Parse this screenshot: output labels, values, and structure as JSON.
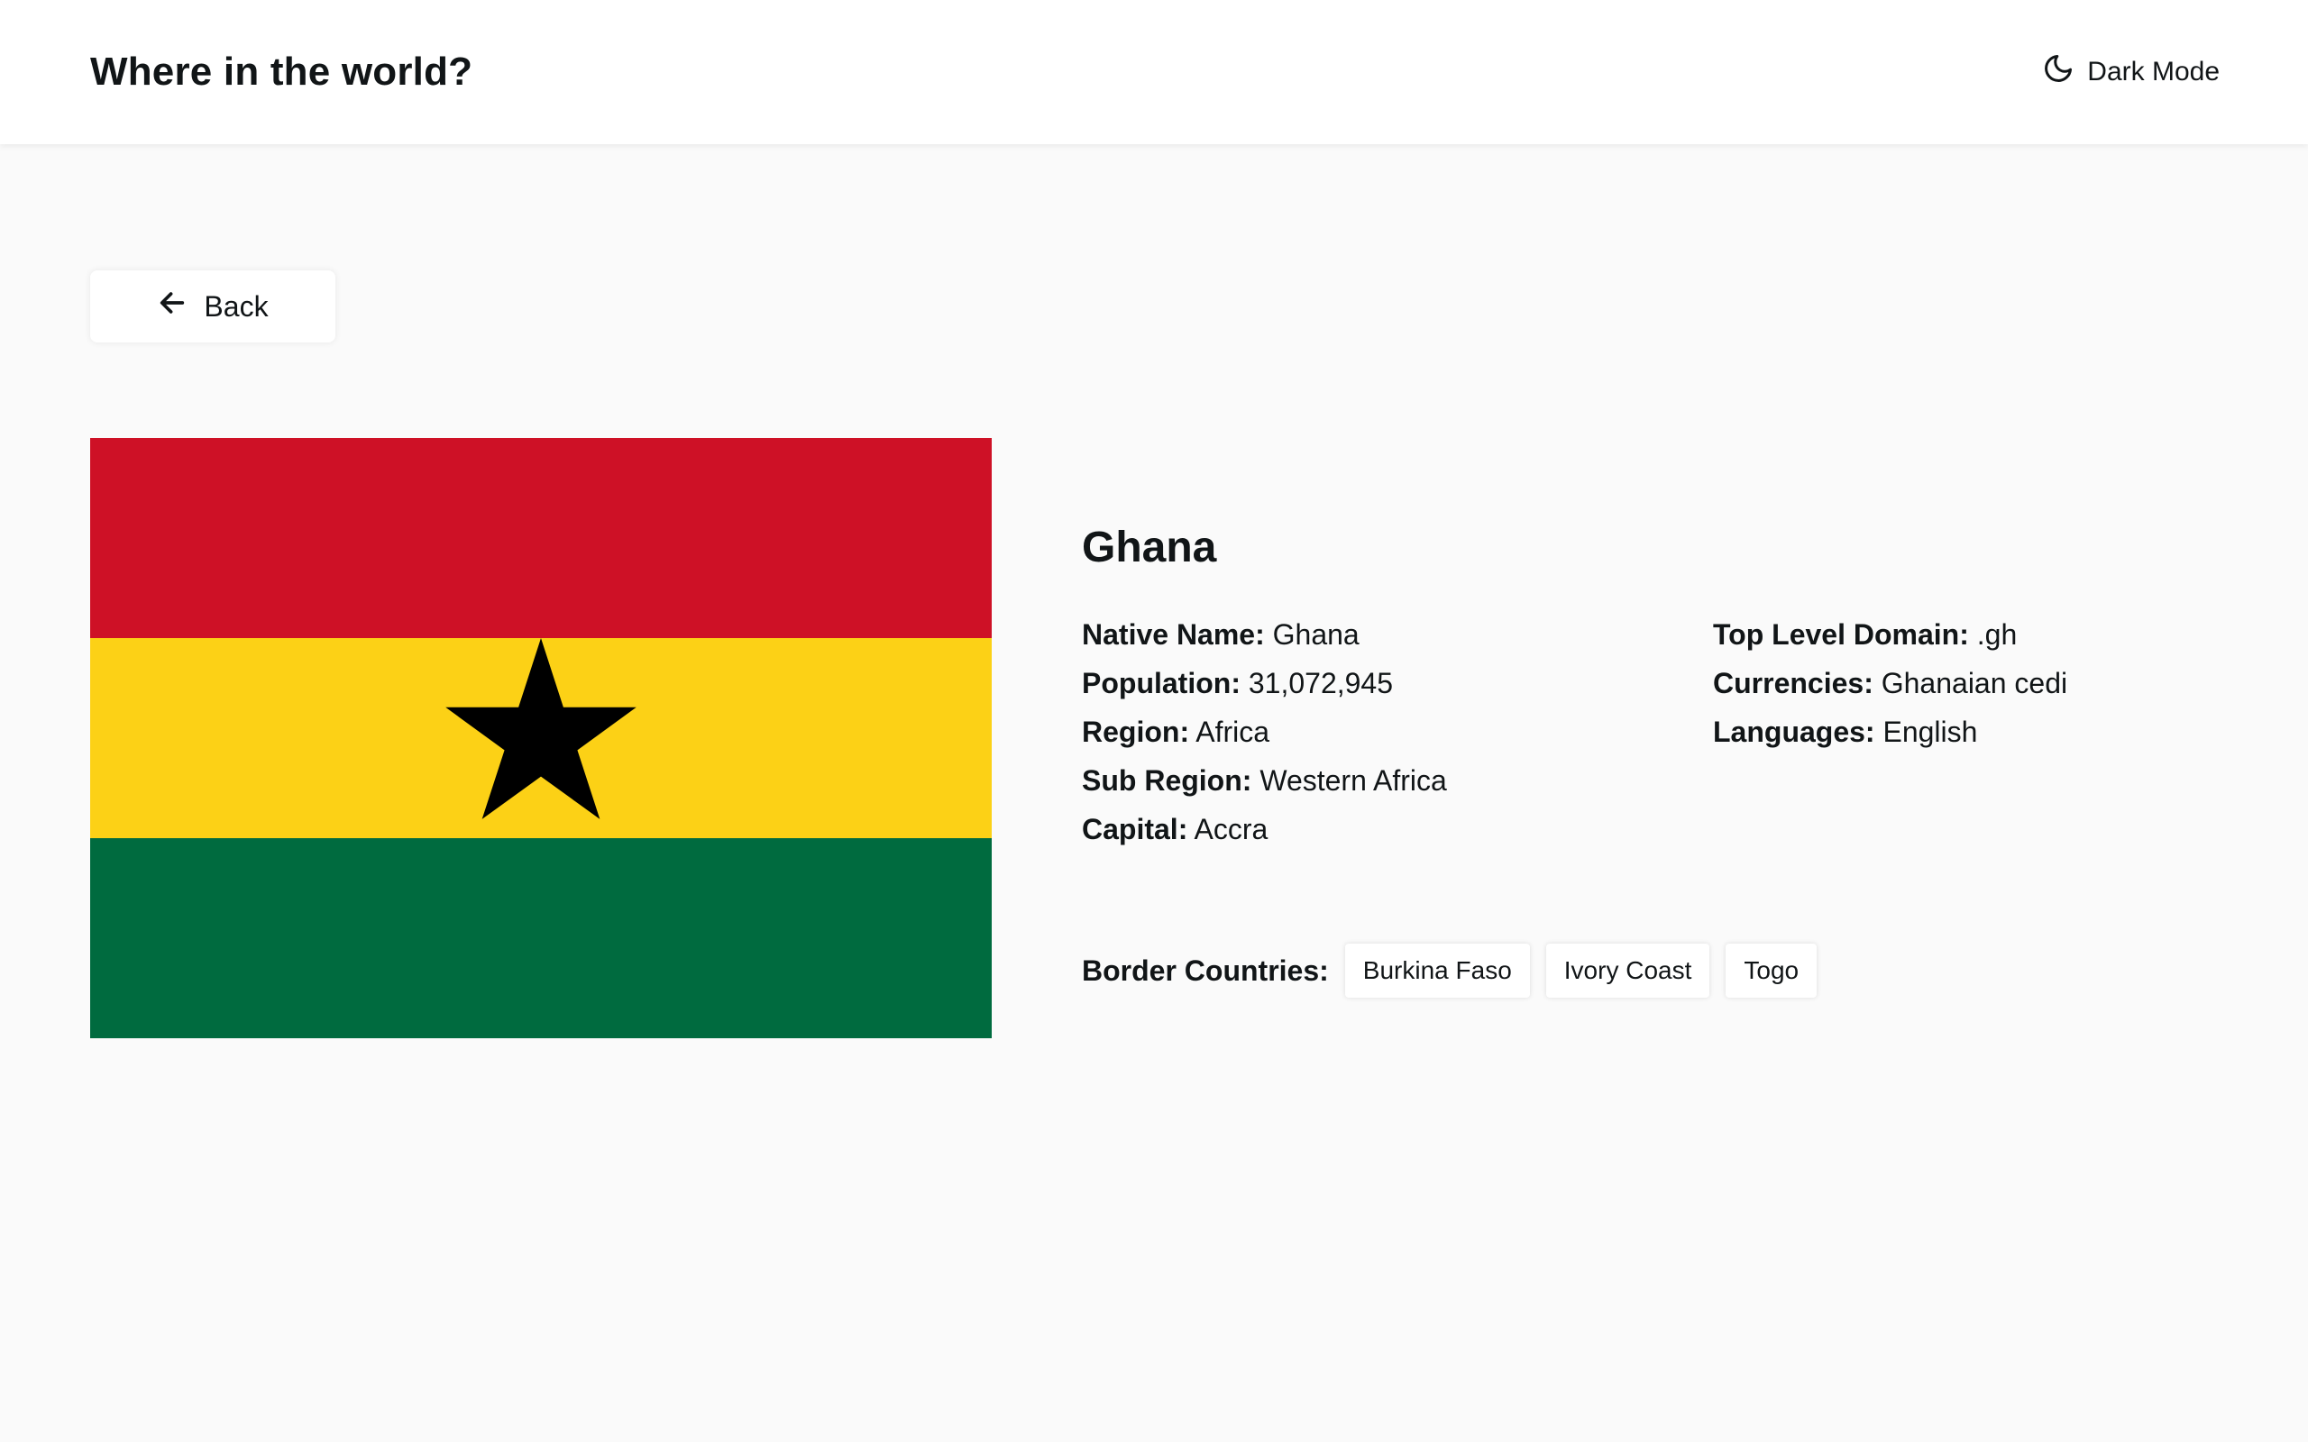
{
  "header": {
    "title": "Where in the world?",
    "dark_mode_label": "Dark Mode",
    "dark_mode_icon": "moon-icon"
  },
  "back_button": {
    "label": "Back",
    "icon": "arrow-left-icon"
  },
  "flag": {
    "icon": "ghana-flag",
    "colors": {
      "top_stripe": "#CE1126",
      "middle_stripe": "#FCD116",
      "bottom_stripe": "#006B3F",
      "star": "#000000"
    }
  },
  "country": {
    "name": "Ghana",
    "left_info": [
      {
        "label": "Native Name:",
        "value": "Ghana"
      },
      {
        "label": "Population:",
        "value": "31,072,945"
      },
      {
        "label": "Region:",
        "value": "Africa"
      },
      {
        "label": "Sub Region:",
        "value": "Western Africa"
      },
      {
        "label": "Capital:",
        "value": "Accra"
      }
    ],
    "right_info": [
      {
        "label": "Top Level Domain:",
        "value": ".gh"
      },
      {
        "label": "Currencies:",
        "value": "Ghanaian cedi"
      },
      {
        "label": "Languages:",
        "value": "English"
      }
    ],
    "border_label": "Border Countries:",
    "borders": [
      "Burkina Faso",
      "Ivory Coast",
      "Togo"
    ]
  },
  "colors": {
    "background": "#fafafa",
    "surface": "#ffffff",
    "text": "#111517"
  }
}
